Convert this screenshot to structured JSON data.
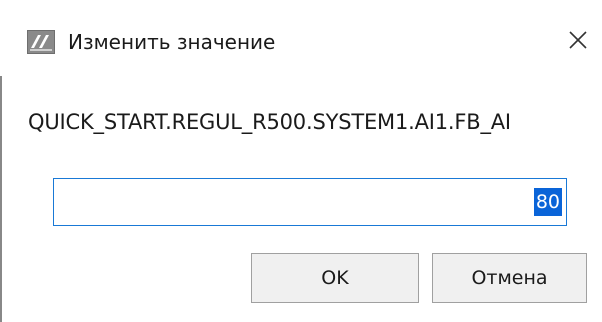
{
  "window": {
    "title": "Изменить значение",
    "icon": "app-logo-icon",
    "close_icon": "close-icon"
  },
  "content": {
    "path_label": "QUICK_START.REGUL_R500.SYSTEM1.AI1.FB_AI",
    "value_input": {
      "value": "80",
      "selected": true
    }
  },
  "buttons": {
    "ok_label": "OK",
    "cancel_label": "Отмена"
  },
  "colors": {
    "input_border": "#1979d6",
    "selection": "#0a64d8",
    "button_bg": "#f0f0f0"
  }
}
